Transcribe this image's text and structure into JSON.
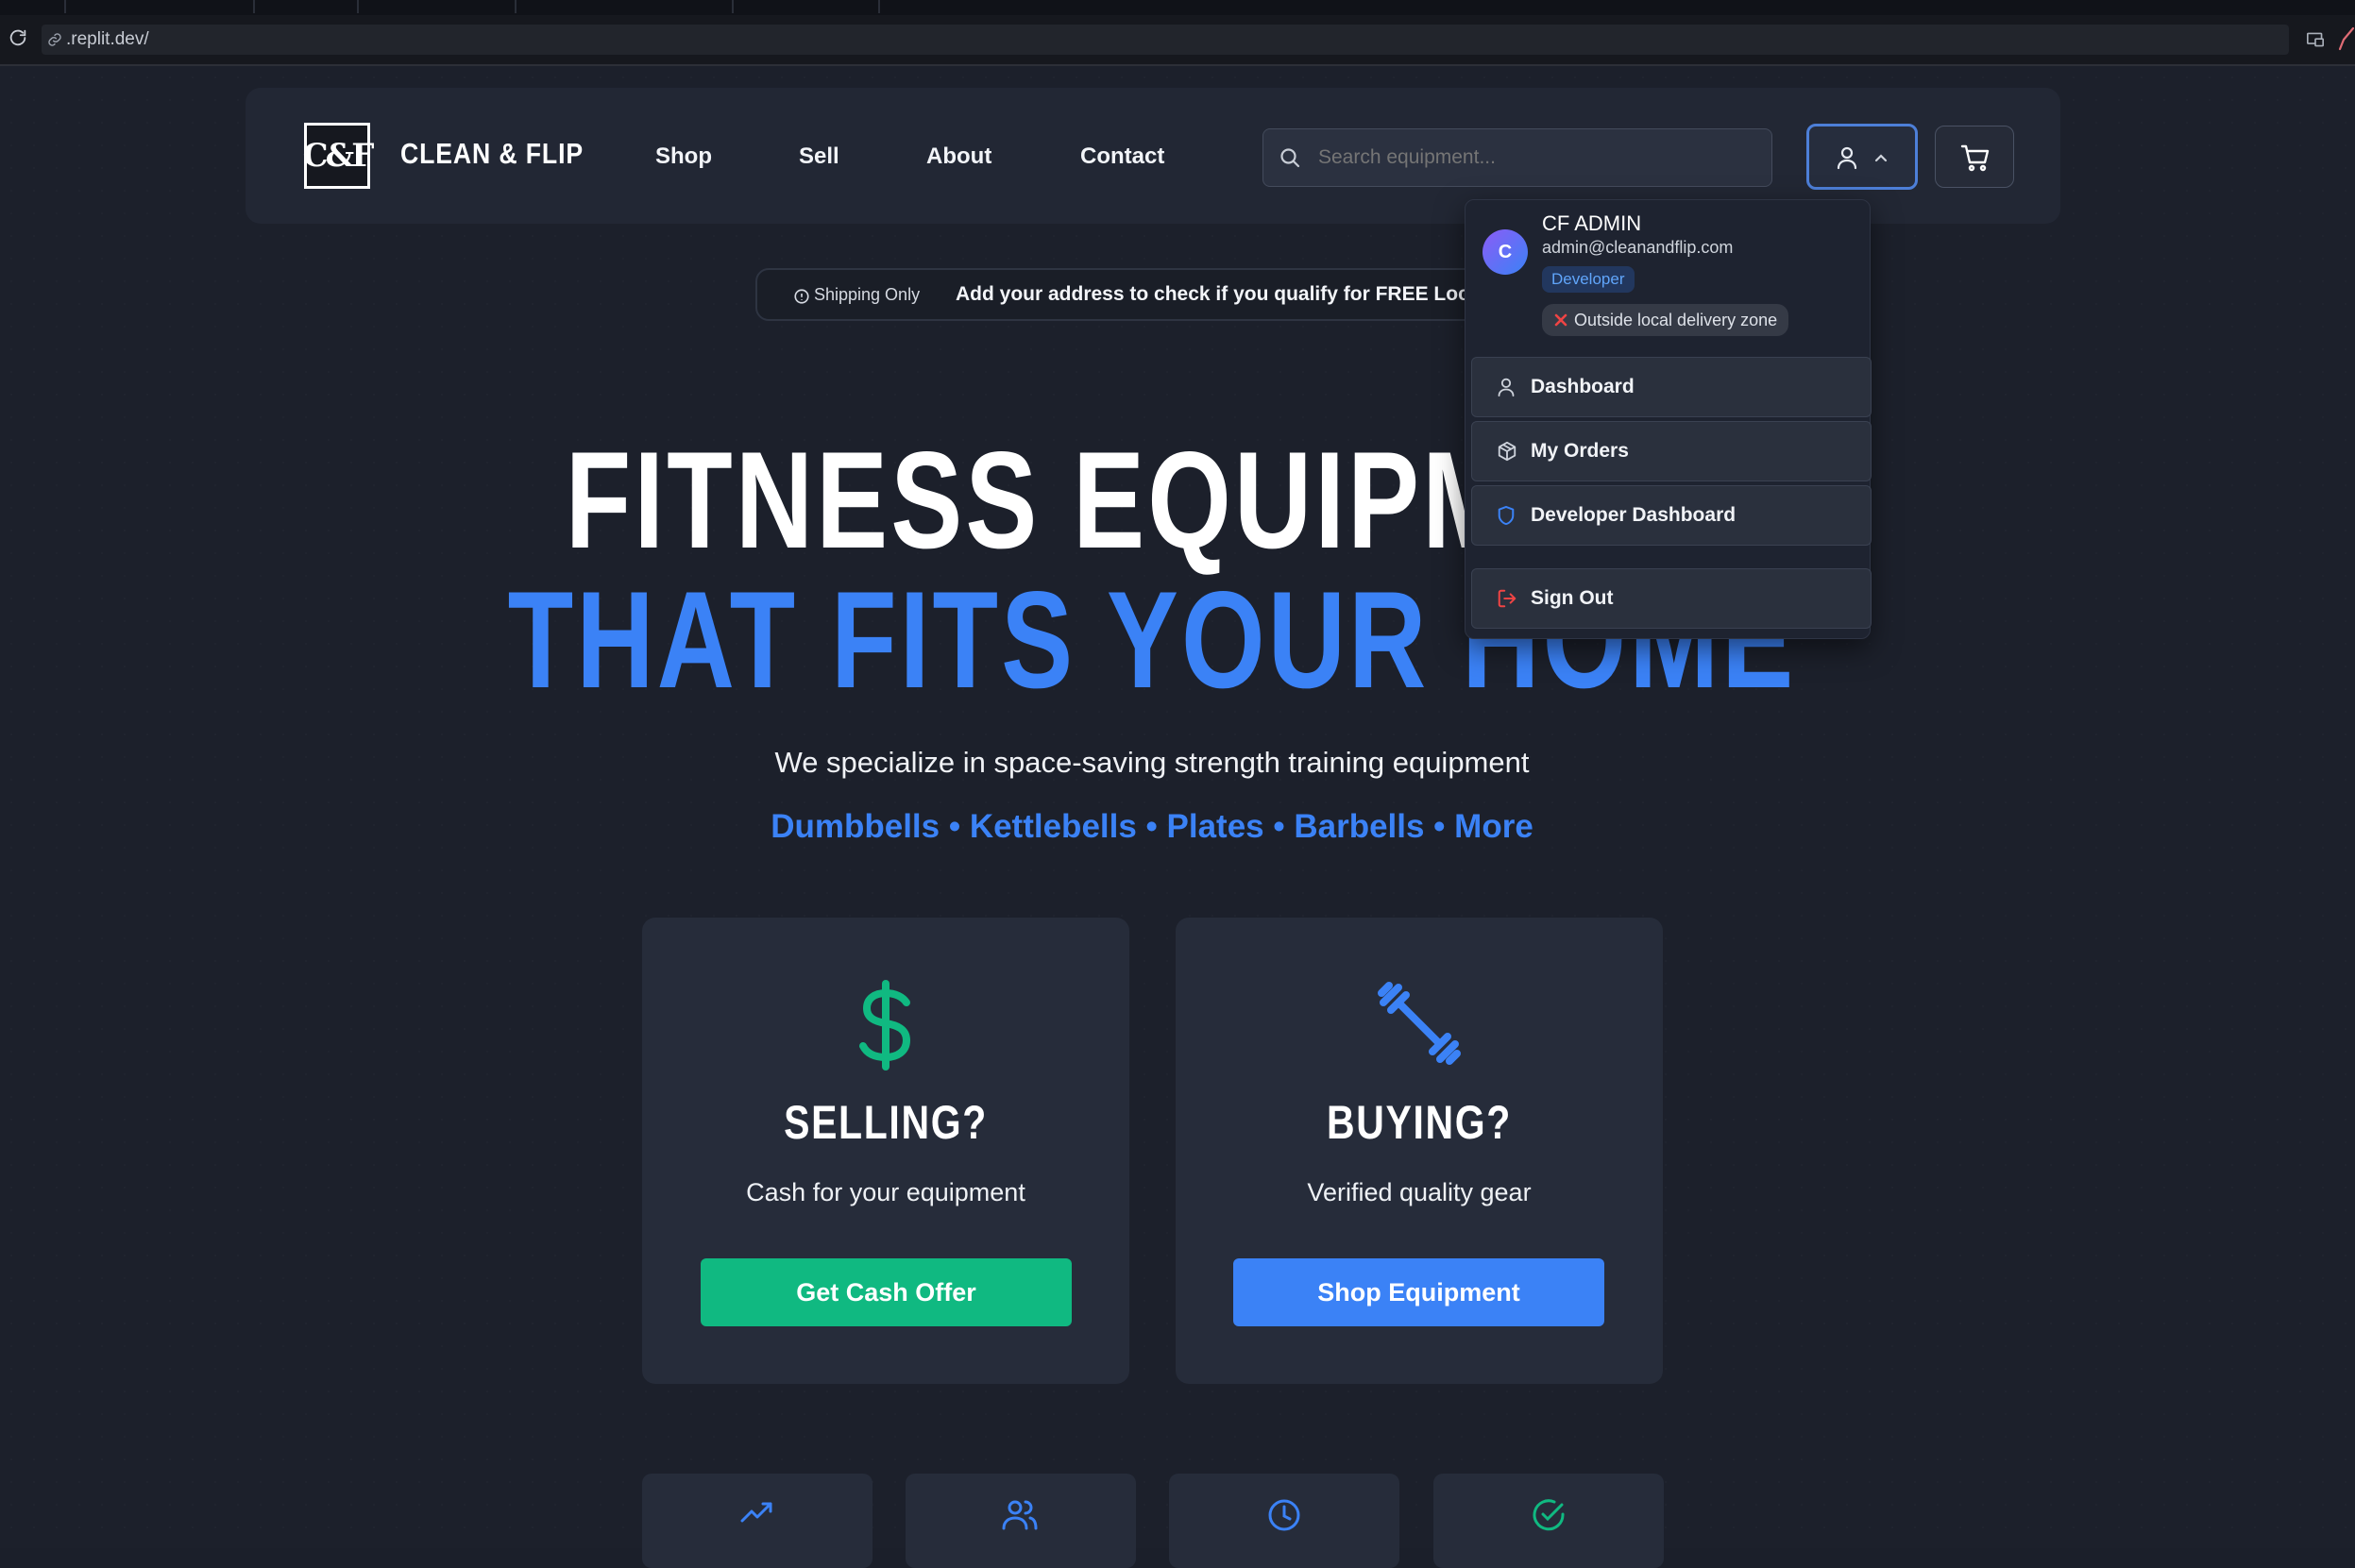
{
  "browser": {
    "url": ".replit.dev/"
  },
  "nav": {
    "logo_mark": "C&F",
    "brand": "CLEAN & FLIP",
    "links": [
      "Shop",
      "Sell",
      "About",
      "Contact"
    ],
    "search_placeholder": "Search equipment..."
  },
  "banner": {
    "label": "Shipping Only",
    "text": "Add your address to check if you qualify for FREE Local Delivery"
  },
  "hero": {
    "line1": "FITNESS EQUIPMENT",
    "line2": "THAT FITS YOUR HOME",
    "tagline": "We specialize in space-saving strength training equipment",
    "categories": "Dumbbells • Kettlebells • Plates • Barbells • More"
  },
  "cards": [
    {
      "title": "SELLING?",
      "subtitle": "Cash for your equipment",
      "button": "Get Cash Offer",
      "icon": "dollar-icon",
      "color": "#10b981"
    },
    {
      "title": "BUYING?",
      "subtitle": "Verified quality gear",
      "button": "Shop Equipment",
      "icon": "dumbbell-icon",
      "color": "#3b82f6"
    }
  ],
  "tiles": [
    {
      "icon": "trending-up-icon"
    },
    {
      "icon": "users-icon"
    },
    {
      "icon": "clock-icon"
    },
    {
      "icon": "check-circle-icon"
    }
  ],
  "user_menu": {
    "avatar_initial": "C",
    "name": "CF ADMIN",
    "email": "admin@cleanandflip.com",
    "role": "Developer",
    "zone_status": "Outside local delivery zone",
    "items": [
      "Dashboard",
      "My Orders",
      "Developer Dashboard",
      "Sign Out"
    ]
  },
  "colors": {
    "accent": "#3b82f6",
    "success": "#10b981",
    "danger": "#ef4444",
    "background": "#1c202b"
  }
}
